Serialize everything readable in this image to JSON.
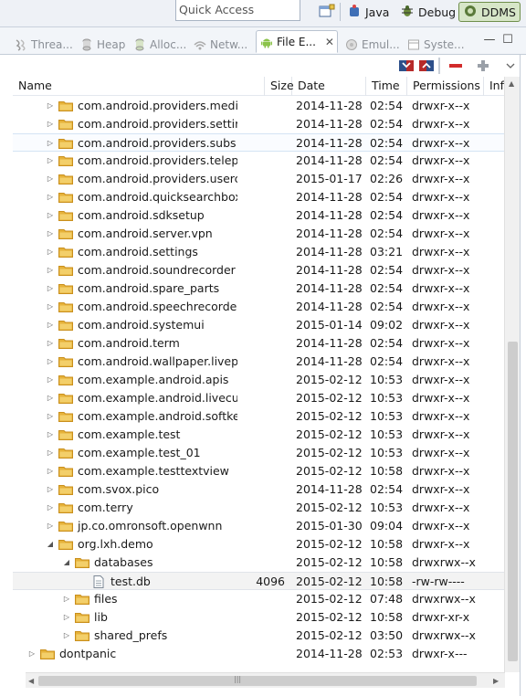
{
  "toolbar": {
    "quick_access_placeholder": "Quick Access",
    "perspectives": [
      {
        "label": "Java",
        "active": false
      },
      {
        "label": "Debug",
        "active": false
      },
      {
        "label": "DDMS",
        "active": true
      }
    ]
  },
  "tabs": [
    {
      "label": "Threa...",
      "icon": "threads-icon",
      "active": false
    },
    {
      "label": "Heap",
      "icon": "heap-icon",
      "active": false
    },
    {
      "label": "Alloc...",
      "icon": "allocation-icon",
      "active": false
    },
    {
      "label": "Netw...",
      "icon": "network-icon",
      "active": false
    },
    {
      "label": "File E...",
      "icon": "android-icon",
      "active": true
    },
    {
      "label": "Emul...",
      "icon": "emulator-icon",
      "active": false
    },
    {
      "label": "Syste...",
      "icon": "system-icon",
      "active": false
    }
  ],
  "table": {
    "columns": [
      "Name",
      "Size",
      "Date",
      "Time",
      "Permissions",
      "Info"
    ],
    "rows": [
      {
        "name": "com.android.providers.medi",
        "size": "",
        "date": "2014-11-28",
        "time": "02:54",
        "perm": "drwxr-x--x",
        "level": 2,
        "expand": "collapsed"
      },
      {
        "name": "com.android.providers.settir",
        "size": "",
        "date": "2014-11-28",
        "time": "02:54",
        "perm": "drwxr-x--x",
        "level": 2,
        "expand": "collapsed"
      },
      {
        "name": "com.android.providers.subs",
        "size": "",
        "date": "2014-11-28",
        "time": "02:54",
        "perm": "drwxr-x--x",
        "level": 2,
        "expand": "collapsed",
        "state": "hover"
      },
      {
        "name": "com.android.providers.telep",
        "size": "",
        "date": "2014-11-28",
        "time": "02:54",
        "perm": "drwxr-x--x",
        "level": 2,
        "expand": "collapsed"
      },
      {
        "name": "com.android.providers.userc",
        "size": "",
        "date": "2015-01-17",
        "time": "02:26",
        "perm": "drwxr-x--x",
        "level": 2,
        "expand": "collapsed"
      },
      {
        "name": "com.android.quicksearchbox",
        "size": "",
        "date": "2014-11-28",
        "time": "02:54",
        "perm": "drwxr-x--x",
        "level": 2,
        "expand": "collapsed"
      },
      {
        "name": "com.android.sdksetup",
        "size": "",
        "date": "2014-11-28",
        "time": "02:54",
        "perm": "drwxr-x--x",
        "level": 2,
        "expand": "collapsed"
      },
      {
        "name": "com.android.server.vpn",
        "size": "",
        "date": "2014-11-28",
        "time": "02:54",
        "perm": "drwxr-x--x",
        "level": 2,
        "expand": "collapsed"
      },
      {
        "name": "com.android.settings",
        "size": "",
        "date": "2014-11-28",
        "time": "03:21",
        "perm": "drwxr-x--x",
        "level": 2,
        "expand": "collapsed"
      },
      {
        "name": "com.android.soundrecorder",
        "size": "",
        "date": "2014-11-28",
        "time": "02:54",
        "perm": "drwxr-x--x",
        "level": 2,
        "expand": "collapsed"
      },
      {
        "name": "com.android.spare_parts",
        "size": "",
        "date": "2014-11-28",
        "time": "02:54",
        "perm": "drwxr-x--x",
        "level": 2,
        "expand": "collapsed"
      },
      {
        "name": "com.android.speechrecorde",
        "size": "",
        "date": "2014-11-28",
        "time": "02:54",
        "perm": "drwxr-x--x",
        "level": 2,
        "expand": "collapsed"
      },
      {
        "name": "com.android.systemui",
        "size": "",
        "date": "2015-01-14",
        "time": "09:02",
        "perm": "drwxr-x--x",
        "level": 2,
        "expand": "collapsed"
      },
      {
        "name": "com.android.term",
        "size": "",
        "date": "2014-11-28",
        "time": "02:54",
        "perm": "drwxr-x--x",
        "level": 2,
        "expand": "collapsed"
      },
      {
        "name": "com.android.wallpaper.livep",
        "size": "",
        "date": "2014-11-28",
        "time": "02:54",
        "perm": "drwxr-x--x",
        "level": 2,
        "expand": "collapsed"
      },
      {
        "name": "com.example.android.apis",
        "size": "",
        "date": "2015-02-12",
        "time": "10:53",
        "perm": "drwxr-x--x",
        "level": 2,
        "expand": "collapsed"
      },
      {
        "name": "com.example.android.livecub",
        "size": "",
        "date": "2015-02-12",
        "time": "10:53",
        "perm": "drwxr-x--x",
        "level": 2,
        "expand": "collapsed"
      },
      {
        "name": "com.example.android.softke",
        "size": "",
        "date": "2015-02-12",
        "time": "10:53",
        "perm": "drwxr-x--x",
        "level": 2,
        "expand": "collapsed"
      },
      {
        "name": "com.example.test",
        "size": "",
        "date": "2015-02-12",
        "time": "10:53",
        "perm": "drwxr-x--x",
        "level": 2,
        "expand": "collapsed"
      },
      {
        "name": "com.example.test_01",
        "size": "",
        "date": "2015-02-12",
        "time": "10:53",
        "perm": "drwxr-x--x",
        "level": 2,
        "expand": "collapsed"
      },
      {
        "name": "com.example.testtextview",
        "size": "",
        "date": "2015-02-12",
        "time": "10:58",
        "perm": "drwxr-x--x",
        "level": 2,
        "expand": "collapsed"
      },
      {
        "name": "com.svox.pico",
        "size": "",
        "date": "2014-11-28",
        "time": "02:54",
        "perm": "drwxr-x--x",
        "level": 2,
        "expand": "collapsed"
      },
      {
        "name": "com.terry",
        "size": "",
        "date": "2015-02-12",
        "time": "10:53",
        "perm": "drwxr-x--x",
        "level": 2,
        "expand": "collapsed"
      },
      {
        "name": "jp.co.omronsoft.openwnn",
        "size": "",
        "date": "2015-01-30",
        "time": "09:04",
        "perm": "drwxr-x--x",
        "level": 2,
        "expand": "collapsed"
      },
      {
        "name": "org.lxh.demo",
        "size": "",
        "date": "2015-02-12",
        "time": "10:58",
        "perm": "drwxr-x--x",
        "level": 2,
        "expand": "expanded"
      },
      {
        "name": "databases",
        "size": "",
        "date": "2015-02-12",
        "time": "10:58",
        "perm": "drwxrwx--x",
        "level": 3,
        "expand": "expanded"
      },
      {
        "name": "test.db",
        "size": "4096",
        "date": "2015-02-12",
        "time": "10:58",
        "perm": "-rw-rw----",
        "level": 4,
        "expand": "none",
        "type": "file",
        "state": "selected"
      },
      {
        "name": "files",
        "size": "",
        "date": "2015-02-12",
        "time": "07:48",
        "perm": "drwxrwx--x",
        "level": 3,
        "expand": "collapsed"
      },
      {
        "name": "lib",
        "size": "",
        "date": "2015-02-12",
        "time": "10:58",
        "perm": "drwxr-xr-x",
        "level": 3,
        "expand": "collapsed"
      },
      {
        "name": "shared_prefs",
        "size": "",
        "date": "2015-02-12",
        "time": "03:50",
        "perm": "drwxrwx--x",
        "level": 3,
        "expand": "collapsed"
      },
      {
        "name": "dontpanic",
        "size": "",
        "date": "2014-11-28",
        "time": "02:53",
        "perm": "drwxr-x---",
        "level": 1,
        "expand": "collapsed"
      }
    ]
  },
  "colors": {
    "folder": "#e6b23a",
    "folder_dark": "#c98f1c",
    "ddms_bg": "#d7e6c8",
    "delete_red": "#d22b2b"
  }
}
